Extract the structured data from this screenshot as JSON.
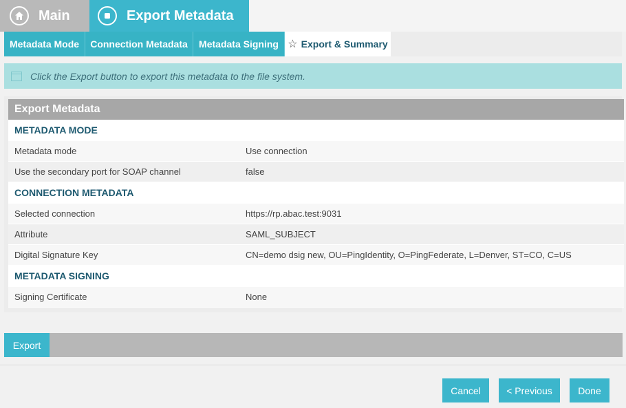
{
  "breadcrumb": {
    "main_label": "Main",
    "export_label": "Export Metadata"
  },
  "tabs": [
    {
      "label": "Metadata Mode"
    },
    {
      "label": "Connection Metadata"
    },
    {
      "label": "Metadata Signing"
    },
    {
      "label": "Export & Summary",
      "active": true
    }
  ],
  "banner": {
    "text": "Click the Export button to export this metadata to the file system."
  },
  "summary": {
    "title": "Export Metadata",
    "sections": [
      {
        "title": "METADATA MODE",
        "rows": [
          {
            "key": "Metadata mode",
            "value": "Use connection"
          },
          {
            "key": "Use the secondary port for SOAP channel",
            "value": "false"
          }
        ]
      },
      {
        "title": "CONNECTION METADATA",
        "rows": [
          {
            "key": "Selected connection",
            "value": "https://rp.abac.test:9031"
          },
          {
            "key": "Attribute",
            "value": "SAML_SUBJECT"
          },
          {
            "key": "Digital Signature Key",
            "value": "CN=demo dsig new, OU=PingIdentity, O=PingFederate, L=Denver, ST=CO, C=US"
          }
        ]
      },
      {
        "title": "METADATA SIGNING",
        "rows": [
          {
            "key": "Signing Certificate",
            "value": "None"
          }
        ]
      }
    ]
  },
  "export_button": "Export",
  "footer": {
    "cancel": "Cancel",
    "previous": "< Previous",
    "done": "Done"
  },
  "colors": {
    "accent": "#3cb6cc",
    "section_title": "#1e5a70",
    "banner_bg": "#aadfe0"
  },
  "icons": {
    "main": "home-icon",
    "export": "stop-icon",
    "active_tab": "star-icon",
    "banner": "window-icon"
  }
}
